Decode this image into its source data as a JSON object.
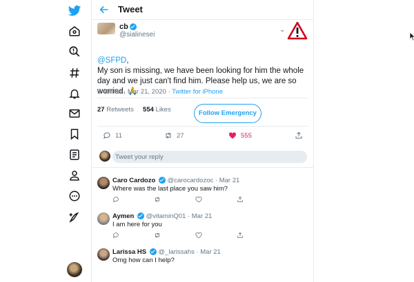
{
  "colors": {
    "accent": "#1da1f2",
    "like": "#e0245e",
    "muted": "#657786",
    "border": "#e6ecf0"
  },
  "sidebar": {
    "items": [
      {
        "icon": "twitter-logo-icon"
      },
      {
        "icon": "home-icon"
      },
      {
        "icon": "search-icon"
      },
      {
        "icon": "hashtag-icon"
      },
      {
        "icon": "notifications-icon"
      },
      {
        "icon": "messages-icon"
      },
      {
        "icon": "bookmark-icon"
      },
      {
        "icon": "lists-icon"
      },
      {
        "icon": "profile-icon"
      },
      {
        "icon": "more-icon"
      },
      {
        "icon": "compose-tweet-icon"
      }
    ]
  },
  "header": {
    "title": "Tweet"
  },
  "tweet": {
    "author_name": "cb",
    "author_handle": "@sialinesei",
    "mention": "@SFPD",
    "after_mention": ",",
    "body": "My son is missing, we have been looking for him the whole day and we just can't find him. Please help us, we are so worried. 🙏",
    "time": "6:40 PM · Mar 21, 2020 · ",
    "source": "Twitter for iPhone",
    "retweets": "27",
    "retweets_label": "Retweets",
    "likes": "554",
    "likes_label": "Likes",
    "follow_button": "Follow Emergency",
    "actions": {
      "replies": "11",
      "retweets": "27",
      "likes": "555"
    }
  },
  "reply_box": {
    "placeholder": "Tweet your reply"
  },
  "replies": [
    {
      "name": "Caro Cardozo",
      "handle": "@carocardozoc · Mar 21",
      "text": "Where was the last place you saw him?"
    },
    {
      "name": "Aymen",
      "handle": "@vitaminQ01 · Mar 21",
      "text": "I am here for you"
    },
    {
      "name": "Larissa HS",
      "handle": "@_larissahs · Mar 21",
      "text": "Omg how can I help?"
    }
  ]
}
